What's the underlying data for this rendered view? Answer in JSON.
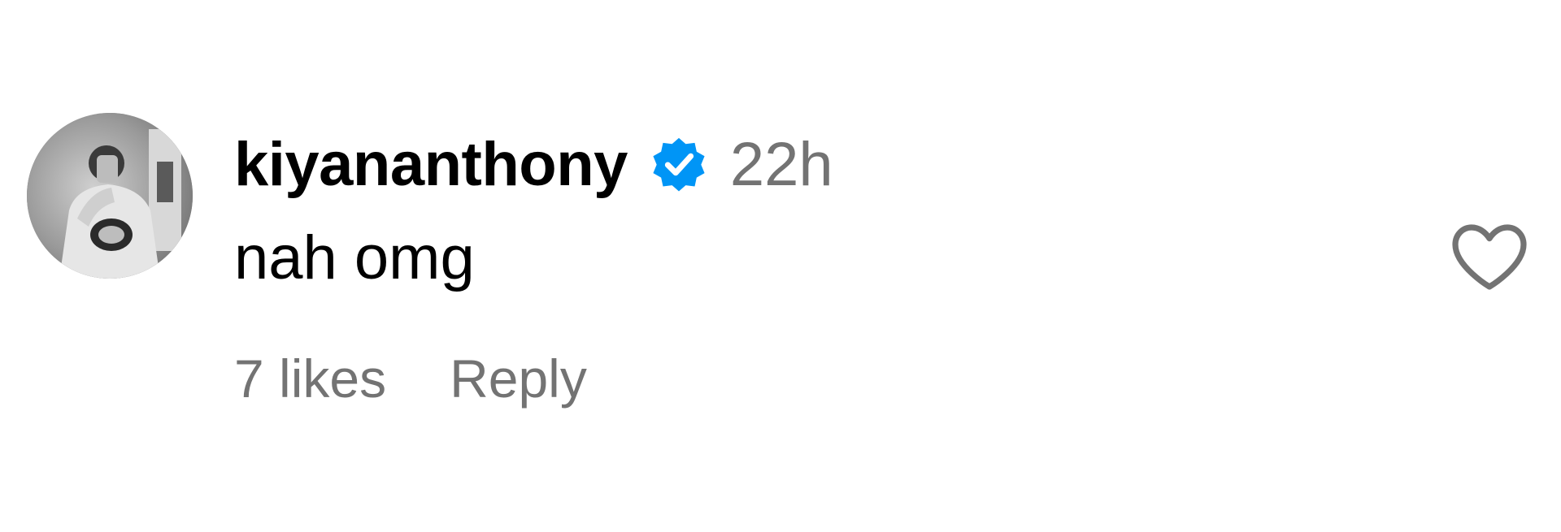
{
  "comment": {
    "username": "kiyananthony",
    "verified": true,
    "timestamp": "22h",
    "text": "nah omg",
    "likes_label": "7 likes",
    "reply_label": "Reply",
    "liked": false
  },
  "icons": {
    "avatar": "avatar-image",
    "verified": "verified-badge-icon",
    "like": "heart-outline-icon"
  },
  "colors": {
    "username": "#000000",
    "text": "#000000",
    "secondary": "#737373",
    "verified_badge": "#0095f6",
    "heart_outline": "#737373",
    "background": "#ffffff"
  }
}
